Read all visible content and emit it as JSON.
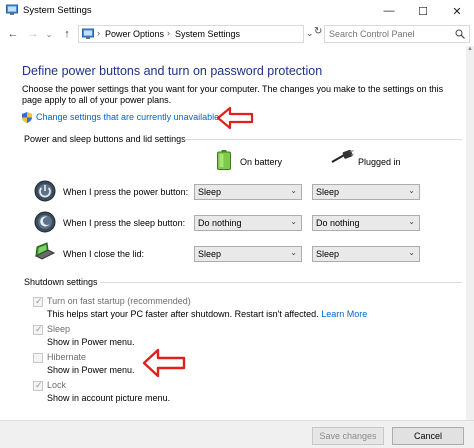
{
  "window": {
    "title": "System Settings",
    "minimize_glyph": "—",
    "maximize_glyph": "☐",
    "close_glyph": "✕"
  },
  "address": {
    "back_glyph": "←",
    "forward_glyph": "→",
    "history_glyph": "⌄",
    "up_glyph": "↑",
    "separator": "›",
    "crumbs": [
      "Power Options",
      "System Settings"
    ],
    "dropdown_glyph": "⌄",
    "refresh_glyph": "↻"
  },
  "search": {
    "placeholder": "Search Control Panel"
  },
  "page": {
    "title": "Define power buttons and turn on password protection",
    "description": "Choose the power settings that you want for your computer. The changes you make to the settings on this page apply to all of your power plans.",
    "change_link": "Change settings that are currently unavailable"
  },
  "power_group": {
    "label": "Power and sleep buttons and lid settings",
    "col_battery": "On battery",
    "col_plugged": "Plugged in",
    "dropdown_glyph": "⌄",
    "rows": [
      {
        "label": "When I press the power button:",
        "battery": "Sleep",
        "plugged": "Sleep"
      },
      {
        "label": "When I press the sleep button:",
        "battery": "Do nothing",
        "plugged": "Do nothing"
      },
      {
        "label": "When I close the lid:",
        "battery": "Sleep",
        "plugged": "Sleep"
      }
    ]
  },
  "shutdown_group": {
    "label": "Shutdown settings",
    "check_glyph": "✓",
    "items": [
      {
        "label": "Turn on fast startup (recommended)",
        "desc": "This helps start your PC faster after shutdown. Restart isn't affected.",
        "link": "Learn More",
        "checked": true
      },
      {
        "label": "Sleep",
        "desc": "Show in Power menu.",
        "checked": true
      },
      {
        "label": "Hibernate",
        "desc": "Show in Power menu.",
        "checked": false
      },
      {
        "label": "Lock",
        "desc": "Show in account picture menu.",
        "checked": true
      }
    ]
  },
  "footer": {
    "save_label": "Save changes",
    "cancel_label": "Cancel"
  },
  "colors": {
    "title_blue": "#1e3287",
    "link_blue": "#0066cc",
    "annotation_red": "#e0201c"
  }
}
